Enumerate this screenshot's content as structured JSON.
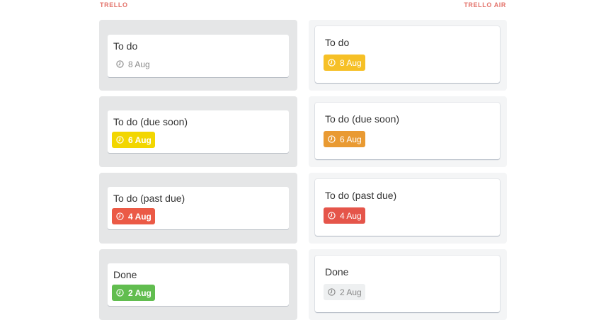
{
  "headers": {
    "left": "TRELLO",
    "right": "TRELLO AIR"
  },
  "icons": {
    "due": "clock-icon"
  },
  "colors": {
    "header": "#e3726a",
    "yellow": "#f2d600",
    "amber": "#f6c026",
    "orange": "#e99a32",
    "red": "#eb5a46",
    "green": "#61bd4f"
  },
  "trello": [
    {
      "title": "To do",
      "due": "8 Aug",
      "status": "default"
    },
    {
      "title": "To do (due soon)",
      "due": "6 Aug",
      "status": "due-soon"
    },
    {
      "title": "To do (past due)",
      "due": "4 Aug",
      "status": "past-due"
    },
    {
      "title": "Done",
      "due": "2 Aug",
      "status": "done"
    }
  ],
  "trello_air": [
    {
      "title": "To do",
      "due": "8 Aug",
      "status": "default"
    },
    {
      "title": "To do (due soon)",
      "due": "6 Aug",
      "status": "due-soon"
    },
    {
      "title": "To do (past due)",
      "due": "4 Aug",
      "status": "past-due"
    },
    {
      "title": "Done",
      "due": "2 Aug",
      "status": "done"
    }
  ]
}
